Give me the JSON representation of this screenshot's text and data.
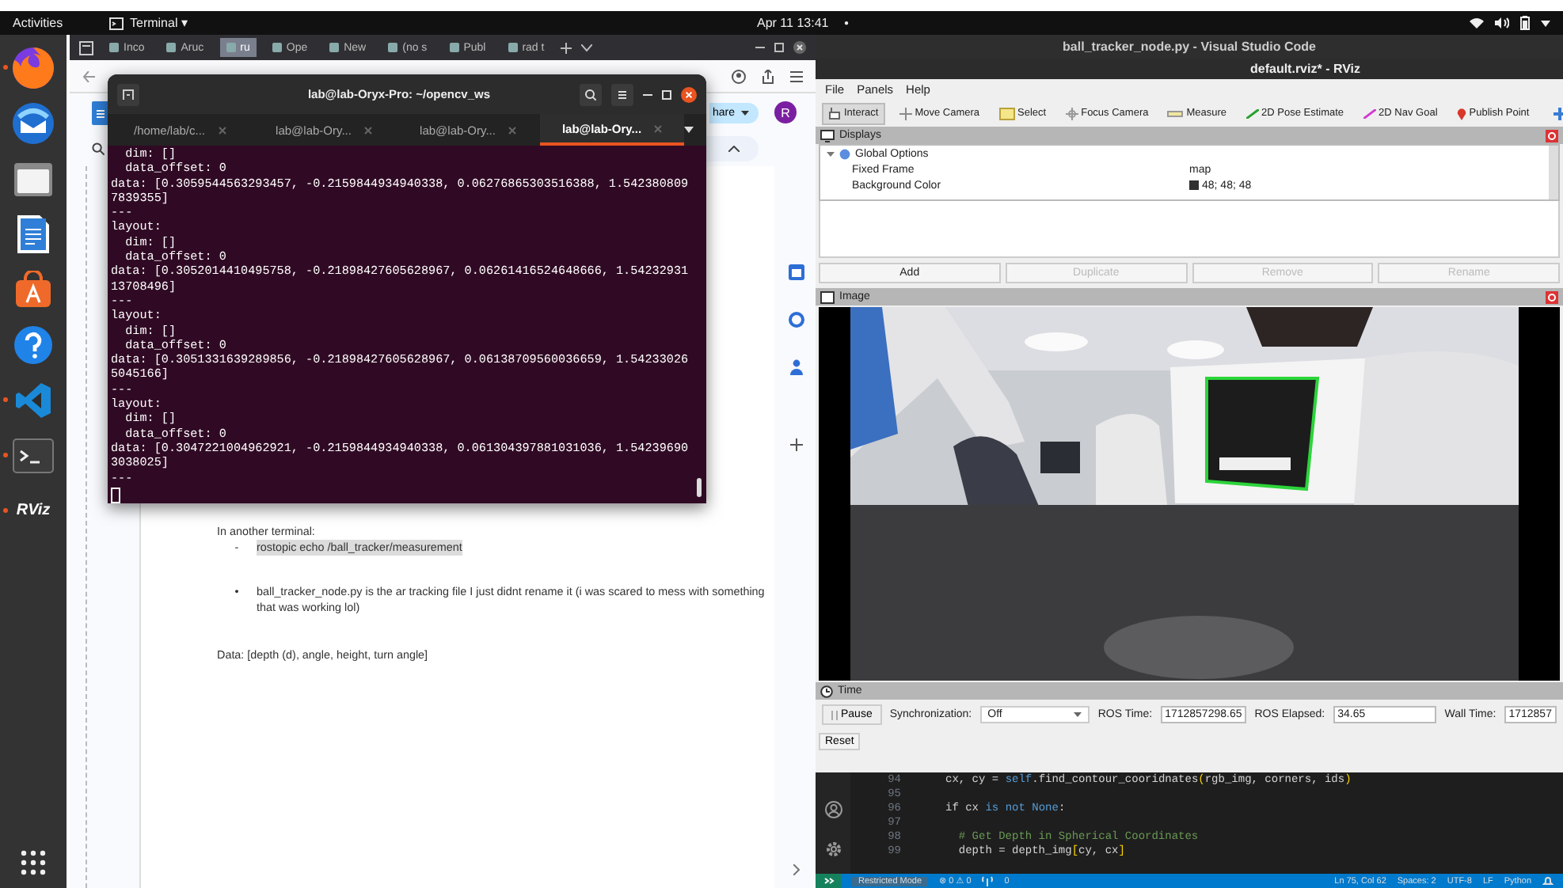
{
  "top_bar": {
    "activities": "Activities",
    "app_menu": "Terminal ▾",
    "clock": "Apr 11  13:41",
    "indicator": "●"
  },
  "dock": {
    "items": [
      {
        "kind": "firefox",
        "running": true
      },
      {
        "kind": "mail",
        "running": false
      },
      {
        "kind": "files",
        "running": false
      },
      {
        "kind": "docs",
        "running": false
      },
      {
        "kind": "store",
        "running": false
      },
      {
        "kind": "help",
        "running": false
      },
      {
        "kind": "code",
        "running": true
      },
      {
        "kind": "terminal",
        "running": true
      },
      {
        "kind": "rviz",
        "label": "RViz",
        "running": true
      }
    ]
  },
  "browser": {
    "tabs": [
      {
        "label": "Inco",
        "selected": false
      },
      {
        "label": "Aruc",
        "selected": false
      },
      {
        "label": "ru",
        "selected": true
      },
      {
        "label": "Ope",
        "selected": false
      },
      {
        "label": "New",
        "selected": false
      },
      {
        "label": "(no s",
        "selected": false
      },
      {
        "label": "Publ",
        "selected": false
      },
      {
        "label": "rad t",
        "selected": false
      }
    ],
    "share_button": "hare",
    "avatar": "R",
    "document": {
      "intro": "In another terminal:",
      "items": [
        {
          "marker": "-",
          "text": "rostopic echo /ball_tracker/measurement",
          "highlighted": true
        },
        {
          "marker": "•",
          "text": "ball_tracker_node.py is the ar tracking file I just didnt rename it  (i was scared to mess with something that was working lol)",
          "highlighted": false
        }
      ],
      "data_line": "Data: [depth (d), angle, height, turn angle]"
    }
  },
  "terminal": {
    "title": "lab@lab-Oryx-Pro: ~/opencv_ws",
    "tabs": [
      {
        "label": "/home/lab/c...",
        "selected": false
      },
      {
        "label": "lab@lab-Ory...",
        "selected": false
      },
      {
        "label": "lab@lab-Ory...",
        "selected": false
      },
      {
        "label": "lab@lab-Ory...",
        "selected": true
      }
    ],
    "lines": [
      "  dim: []",
      "  data_offset: 0",
      "data: [0.3059544563293457, -0.2159844934940338, 0.06276865303516388, 1.542380809",
      "7839355]",
      "---",
      "layout:",
      "  dim: []",
      "  data_offset: 0",
      "data: [0.3052014410495758, -0.21898427605628967, 0.06261416524648666, 1.54232931",
      "13708496]",
      "---",
      "layout:",
      "  dim: []",
      "  data_offset: 0",
      "data: [0.3051331639289856, -0.21898427605628967, 0.06138709560036659, 1.54233026",
      "5045166]",
      "---",
      "layout:",
      "  dim: []",
      "  data_offset: 0",
      "data: [0.3047221004962921, -0.2159844934940338, 0.061304397881031036, 1.54239690",
      "3038025]",
      "---"
    ]
  },
  "vscode": {
    "title": "ball_tracker_node.py - Visual Studio Code",
    "code": [
      {
        "number": "94",
        "tokens": [
          {
            "t": "cx, cy = ",
            "kind": "plain"
          },
          {
            "t": "self",
            "kind": "self"
          },
          {
            "t": ".find_contour_cooridnates",
            "kind": "plain"
          },
          {
            "t": "(",
            "kind": "bracket"
          },
          {
            "t": "rgb_img, corners, ids",
            "kind": "plain"
          },
          {
            "t": ")",
            "kind": "bracket"
          }
        ]
      },
      {
        "number": "95"
      },
      {
        "number": "96",
        "tokens": [
          {
            "t": "if cx ",
            "kind": "plain"
          },
          {
            "t": "is not None",
            "kind": "keyword"
          },
          {
            "t": ":",
            "kind": "plain"
          }
        ]
      },
      {
        "number": "97"
      },
      {
        "number": "98",
        "tokens": [
          {
            "t": "  # Get Depth in Spherical Coordinates",
            "kind": "comment"
          }
        ]
      },
      {
        "number": "99",
        "tokens": [
          {
            "t": "  depth = depth_img",
            "kind": "plain"
          },
          {
            "t": "[",
            "kind": "bracket"
          },
          {
            "t": "cy, cx",
            "kind": "plain"
          },
          {
            "t": "]",
            "kind": "bracket"
          }
        ]
      }
    ],
    "status": {
      "mode": "Restricted Mode",
      "problems": "⊗ 0 ⚠ 0",
      "ports": "0",
      "right": [
        "Ln 75, Col 62",
        "Spaces: 2",
        "UTF-8",
        "LF",
        "Python"
      ]
    }
  },
  "rviz": {
    "title": "default.rviz* - RViz",
    "menu": [
      "File",
      "Panels",
      "Help"
    ],
    "tools": [
      {
        "label": "Interact",
        "kind": "interact",
        "selected": true
      },
      {
        "label": "Move Camera",
        "kind": "move",
        "selected": false
      },
      {
        "label": "Select",
        "kind": "select",
        "selected": false
      },
      {
        "label": "Focus Camera",
        "kind": "focus",
        "selected": false
      },
      {
        "label": "Measure",
        "kind": "measure",
        "selected": false
      },
      {
        "label": "2D Pose Estimate",
        "kind": "pose",
        "selected": false
      },
      {
        "label": "2D Nav Goal",
        "kind": "nav",
        "selected": false
      },
      {
        "label": "Publish Point",
        "kind": "point",
        "selected": false
      }
    ],
    "displays": {
      "title": "Displays",
      "root": {
        "name": "Global Options",
        "expanded": true,
        "children": [
          {
            "name": "Fixed Frame",
            "value": "map"
          },
          {
            "name": "Background Color",
            "value": "48; 48; 48",
            "color": "#303030"
          }
        ]
      },
      "buttons": [
        {
          "label": "Add",
          "disabled": false
        },
        {
          "label": "Duplicate",
          "disabled": true
        },
        {
          "label": "Remove",
          "disabled": true
        },
        {
          "label": "Rename",
          "disabled": true
        }
      ]
    },
    "image_panel": {
      "title": "Image"
    },
    "time_panel": {
      "title": "Time",
      "pause": "Pause",
      "sync_label": "Synchronization:",
      "sync_value": "Off",
      "ros_time_label": "ROS Time:",
      "ros_time": "1712857298.65",
      "ros_elapsed_label": "ROS Elapsed:",
      "ros_elapsed": "34.65",
      "wall_time_label": "Wall Time:",
      "wall_time": "1712857",
      "reset": "Reset"
    }
  }
}
